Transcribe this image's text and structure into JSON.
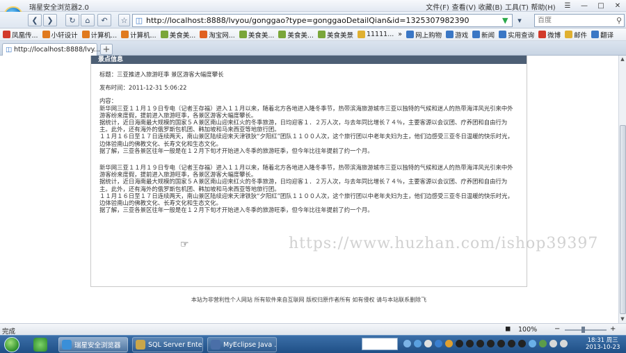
{
  "browser": {
    "title": "瑞星安全浏览器2.0",
    "menu": [
      "文件(F)",
      "查看(V)",
      "收藏(B)",
      "工具(T)",
      "帮助(H)"
    ],
    "window_buttons": [
      "☰",
      "—",
      "□",
      "✕"
    ],
    "address": "http://localhost:8888/lvyou/gonggao?type=gonggaoDetailQian&id=1325307982390",
    "search_placeholder": "百度"
  },
  "bookmarks": [
    {
      "label": "凤凰传...",
      "color": "#d23a2a"
    },
    {
      "label": "小轩设计",
      "color": "#e07a1f"
    },
    {
      "label": "计算机...",
      "color": "#e07a1f"
    },
    {
      "label": "计算机...",
      "color": "#e07a1f"
    },
    {
      "label": "美食美...",
      "color": "#7aa63a"
    },
    {
      "label": "淘宝网...",
      "color": "#e06020"
    },
    {
      "label": "美食美...",
      "color": "#7aa63a"
    },
    {
      "label": "美食美...",
      "color": "#7aa63a"
    },
    {
      "label": "美食美景",
      "color": "#7aa63a"
    },
    {
      "label": "11111...",
      "color": "#e0b030"
    },
    {
      "label": "»",
      "color": ""
    },
    {
      "label": "网上购物",
      "color": "#3a77c5"
    },
    {
      "label": "游戏",
      "color": "#3a77c5"
    },
    {
      "label": "新闻",
      "color": "#3a77c5"
    },
    {
      "label": "实用查询",
      "color": "#3a77c5"
    },
    {
      "label": "微博",
      "color": "#d23a2a"
    },
    {
      "label": "邮件",
      "color": "#e0b030"
    },
    {
      "label": "翻译",
      "color": "#3a77c5"
    }
  ],
  "tab": {
    "label": "http://localhost:8888/lvy...",
    "close": "✕",
    "new_tab": "+"
  },
  "page": {
    "panel_title": "景点信息",
    "title_line": "标题：三亚推进入旅游旺季 景区游客大幅度攀长",
    "date_line": "发布时间：2011-12-31 5:06:22",
    "content_label": "内容：",
    "paragraphs": [
      [
        "新华网三亚１１月１９日专电（记者王存福）进入１１月以来，随着北方各地进入隆冬季节，热带滨海旅游城市三亚以独特的气候和迷人的热带海洋风光引来中外游客纷来度假，提前进入旅游旺季，各景区游客大幅度攀长。",
        "据统计，近日海南最大规模的国家５Ａ景区南山迎来红火的冬季旅游，日均迎客１．２万人次，与去年同比增长７４％，主要客源以会议团、疗养团和自由行为主。此外，还有海外的俄罗斯包机团、韩加坡和马来西亚等地旅行团。",
        "１１月１６日至１７日连续两天，南山景区陆续迎来天津铁狄“夕阳红”团队１１００人次，这个旅行团以中老年夫妇为主，他们边感受三亚冬日温暖的快乐时光，边体验南山的佛教文化、长寿文化和生态文化。",
        "据了解，三亚各景区往年一般是在１２月下旬才开始进入冬季的旅游旺季，但今年比往年提前了约一个月。"
      ],
      [
        "新华网三亚１１月１９日专电（记者王存福）进入１１月以来，随着北方各地进入隆冬季节，热带滨海旅游城市三亚以独特的气候和迷人的热带海洋风光引来中外游客纷来度假，提前进入旅游旺季，各景区游客大幅度攀长。",
        "据统计，近日海南最大规模的国家５Ａ景区南山迎来红火的冬季旅游，日均迎客１．２万人次，与去年同比增长７４％，主要客源以会议团、疗养团和自由行为主。此外，还有海外的俄罗斯包机团、韩加坡和马来西亚等地旅行团。",
        "１１月１６日至１７日连续两天，南山景区陆续迎来天津铁狄“夕阳红”团队１１００人次，这个旅行团以中老年夫妇为主，他们边感受三亚冬日温暖的快乐时光，边体验南山的佛教文化、长寿文化和生态文化。",
        "据了解，三亚各景区往年一般是在１２月下旬才开始进入冬季的旅游旺季，但今年比往年提前了约一个月。"
      ]
    ],
    "footer": "本站为非营利性个人网站  所有软件来自互联网  版权归原作者所有  如有侵权  请与本站联系删除飞",
    "watermark": "https://www.huzhan.com/ishop39397"
  },
  "status": {
    "text": "完成",
    "zoom": "100%"
  },
  "taskbar": {
    "tasks": [
      {
        "label": "瑞星安全浏览器",
        "color": "#3a8fd8"
      },
      {
        "label": "SQL Server Ente...",
        "color": "#c9a64a"
      },
      {
        "label": "MyEclipse Java ...",
        "color": "#4a6fa8"
      }
    ],
    "clock_time": "18:31 周三",
    "clock_date": "2013-10-23"
  }
}
